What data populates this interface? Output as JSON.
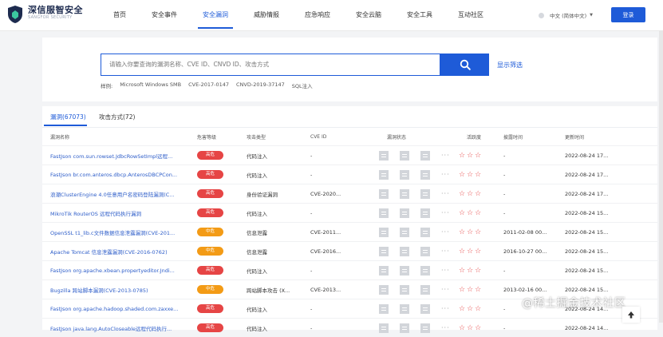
{
  "brand": {
    "title": "深信服智安全",
    "subtitle": "SANGFOR SECURITY"
  },
  "nav": [
    "首页",
    "安全事件",
    "安全漏洞",
    "威胁情报",
    "应急响应",
    "安全云脑",
    "安全工具",
    "互动社区"
  ],
  "lang": "中文 (简体中文)",
  "login": "登录",
  "search": {
    "placeholder": "请输入你要查询的漏洞名称、CVE ID、CNVD ID、攻击方式",
    "advanced": "显示筛选",
    "examples_label": "样例:",
    "examples": [
      "Microsoft Windows SMB",
      "CVE-2017-0147",
      "CNVD-2019-37147",
      "SQL注入"
    ]
  },
  "tabs": [
    "漏洞(67073)",
    "攻击方式(72)"
  ],
  "table": {
    "headers": [
      "漏洞名称",
      "危害等级",
      "攻击类型",
      "CVE ID",
      "漏洞状态",
      "活跃度",
      "披露时间",
      "更新时间"
    ],
    "rows": [
      {
        "name": "FastJson com.sun.rowset.JdbcRowSetImpl远程...",
        "level": "高危",
        "type": "代码注入",
        "cve": "-",
        "disclosed": "-",
        "updated": "2022-08-24 17..."
      },
      {
        "name": "FastJson br.com.anteros.dbcp.AnterosDBCPCon...",
        "level": "高危",
        "type": "代码注入",
        "cve": "-",
        "disclosed": "-",
        "updated": "2022-08-24 17..."
      },
      {
        "name": "浪潮ClusterEngine 4.0任意用户名密码登陆漏洞(C...",
        "level": "高危",
        "type": "身份验证漏洞",
        "cve": "CVE-2020...",
        "disclosed": "-",
        "updated": "2022-08-24 17..."
      },
      {
        "name": "MikroTik RouterOS 远程代码执行漏洞",
        "level": "高危",
        "type": "代码注入",
        "cve": "-",
        "disclosed": "-",
        "updated": "2022-08-24 15..."
      },
      {
        "name": "OpenSSL t1_lib.c文件数据信息泄露漏洞(CVE-201...",
        "level": "中危",
        "type": "信息泄露",
        "cve": "CVE-2011...",
        "disclosed": "2011-02-08 00...",
        "updated": "2022-08-24 15..."
      },
      {
        "name": "Apache Tomcat 信息泄露漏洞(CVE-2016-0762)",
        "level": "中危",
        "type": "信息泄露",
        "cve": "CVE-2016...",
        "disclosed": "2016-10-27 00...",
        "updated": "2022-08-24 15..."
      },
      {
        "name": "FastJson org.apache.xbean.propertyeditor.Jndi...",
        "level": "高危",
        "type": "代码注入",
        "cve": "-",
        "disclosed": "-",
        "updated": "2022-08-24 15..."
      },
      {
        "name": "Bugzilla 跨站脚本漏洞(CVE-2013-0785)",
        "level": "中危",
        "type": "跨站脚本攻击 (X...",
        "cve": "CVE-2013...",
        "disclosed": "2013-02-16 00...",
        "updated": "2022-08-24 15..."
      },
      {
        "name": "FastJson org.apache.hadoop.shaded.com.zaxxe...",
        "level": "高危",
        "type": "代码注入",
        "cve": "-",
        "disclosed": "-",
        "updated": "2022-08-24 14..."
      },
      {
        "name": "FastJson java.lang.AutoCloseable远程代码执行...",
        "level": "高危",
        "type": "代码注入",
        "cve": "-",
        "disclosed": "-",
        "updated": "2022-08-24 14..."
      }
    ]
  },
  "watermark": "@稀土掘金技术社区",
  "colors": {
    "accent": "#1e5bd8",
    "high": "#e64545",
    "mid": "#f39b16"
  }
}
